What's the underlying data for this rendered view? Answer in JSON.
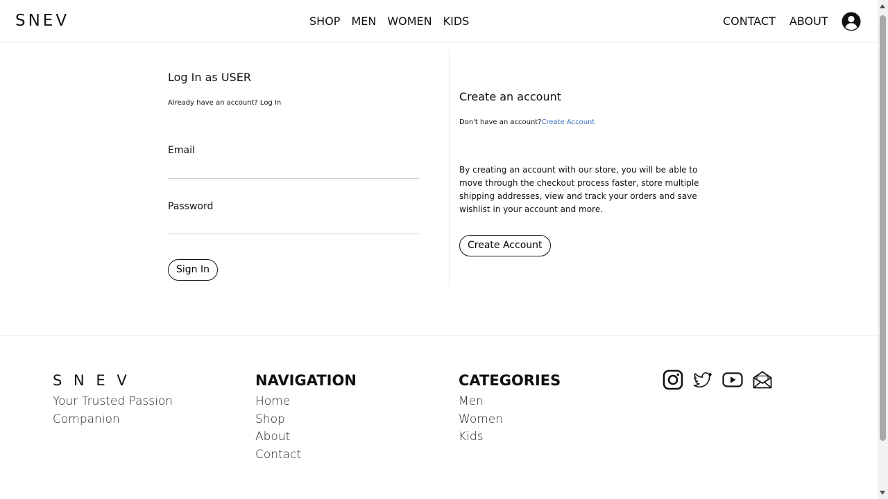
{
  "header": {
    "logo": "SNEV",
    "nav": [
      "SHOP",
      "MEN",
      "WOMEN",
      "KIDS"
    ],
    "right": [
      "CONTACT",
      "ABOUT"
    ],
    "user_icon": "user-circle-icon"
  },
  "login": {
    "title": "Log In as USER",
    "prompt": "Already have an account? Log In",
    "email_label": "Email",
    "email_value": "",
    "password_label": "Password",
    "password_value": "",
    "button": "Sign In"
  },
  "register": {
    "title": "Create an account",
    "prompt": "Don't have an account?",
    "prompt_link": "Create Account",
    "description": "By creating an account with our store, you will be able to move through the checkout process faster, store multiple shipping addresses, view and track your orders and save wishlist in your account and more.",
    "button": "Create Account"
  },
  "footer": {
    "brand": "S N E V",
    "tagline_1": "Your Trusted Passion",
    "tagline_2": "Companion",
    "navigation_title": "NAVIGATION",
    "navigation": [
      "Home",
      "Shop",
      "About",
      "Contact"
    ],
    "categories_title": "CATEGORIES",
    "categories": [
      "Men",
      "Women",
      "Kids"
    ],
    "social_icons": [
      "instagram-icon",
      "twitter-icon",
      "youtube-icon",
      "mail-icon"
    ]
  },
  "colors": {
    "link": "#3b6fc0",
    "text": "#111111"
  }
}
